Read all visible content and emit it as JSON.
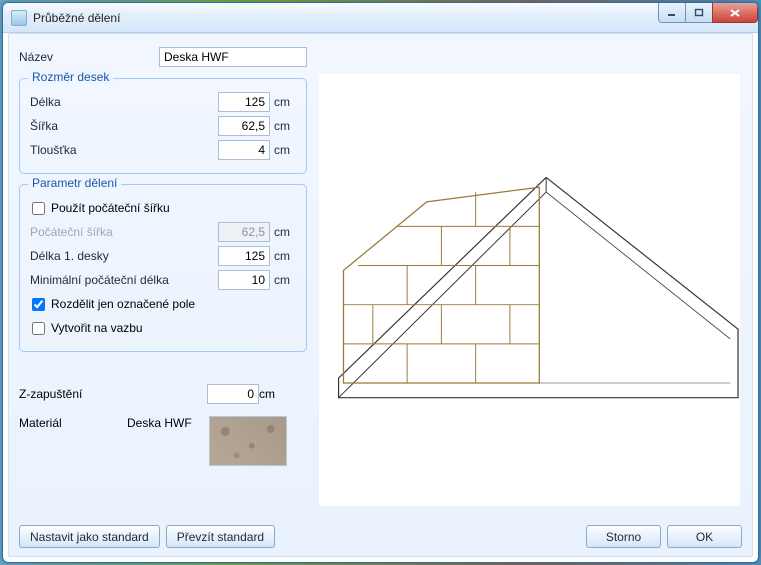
{
  "window": {
    "title": "Průběžné dělení"
  },
  "name": {
    "label": "Název",
    "value": "Deska HWF"
  },
  "dims": {
    "legend": "Rozměr desek",
    "length": {
      "label": "Délka",
      "value": "125",
      "unit": "cm"
    },
    "width": {
      "label": "Šířka",
      "value": "62,5",
      "unit": "cm"
    },
    "thick": {
      "label": "Tloušťka",
      "value": "4",
      "unit": "cm"
    }
  },
  "params": {
    "legend": "Parametr dělení",
    "use_start_width": {
      "label": "Použít počáteční šířku",
      "checked": false
    },
    "start_width": {
      "label": "Počáteční šířka",
      "value": "62,5",
      "unit": "cm"
    },
    "first_len": {
      "label": "Délka 1. desky",
      "value": "125",
      "unit": "cm"
    },
    "min_start": {
      "label": "Minimální počáteční délka",
      "value": "10",
      "unit": "cm"
    },
    "only_marked": {
      "label": "Rozdělit jen označené pole",
      "checked": true
    },
    "on_bond": {
      "label": "Vytvořit na vazbu",
      "checked": false
    }
  },
  "z_offset": {
    "label": "Z-zapuštění",
    "value": "0",
    "unit": "cm"
  },
  "material": {
    "label": "Materiál",
    "value": "Deska HWF"
  },
  "buttons": {
    "set_std": "Nastavit jako standard",
    "take_std": "Převzít standard",
    "cancel": "Storno",
    "ok": "OK"
  }
}
